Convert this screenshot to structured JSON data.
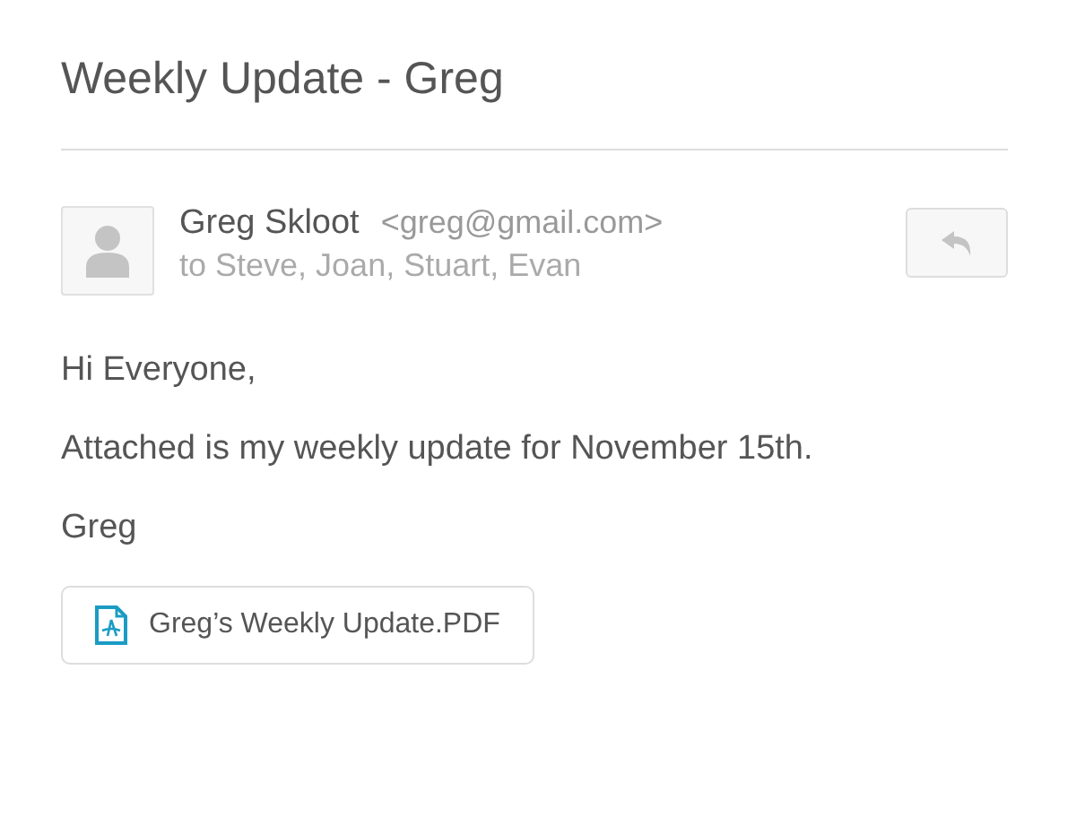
{
  "subject": "Weekly Update - Greg",
  "sender": {
    "name": "Greg Skloot",
    "email": "<greg@gmail.com>",
    "recipients": "to Steve, Joan, Stuart, Evan"
  },
  "body": [
    "Hi Everyone,",
    "Attached is my weekly update for November 15th.",
    "Greg"
  ],
  "attachments": [
    {
      "filename": "Greg’s Weekly Update.PDF"
    }
  ]
}
